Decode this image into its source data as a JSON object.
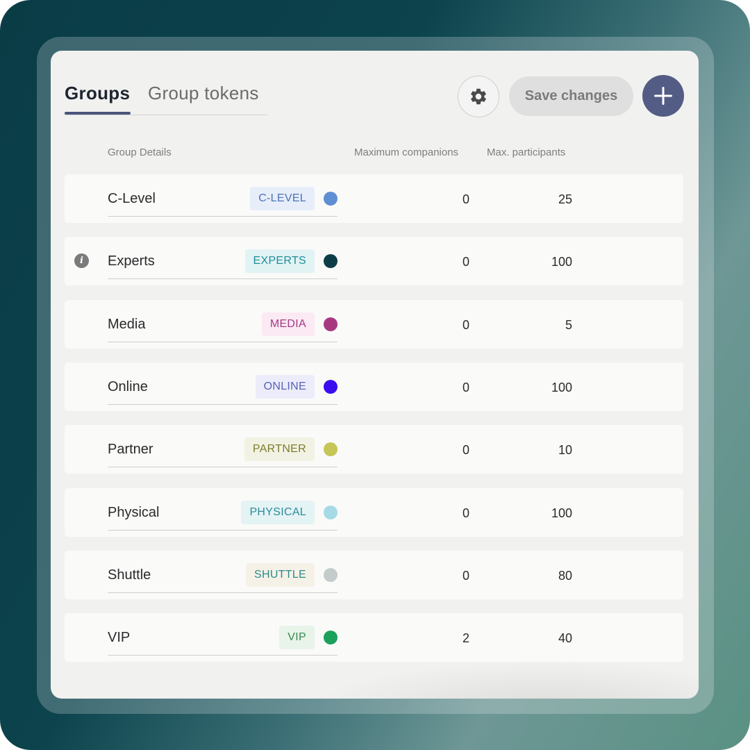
{
  "tabs": [
    {
      "label": "Groups",
      "active": true
    },
    {
      "label": "Group tokens",
      "active": false
    }
  ],
  "toolbar": {
    "settings_icon": "gear-icon",
    "save_label": "Save changes",
    "add_icon": "plus-icon"
  },
  "columns": {
    "details": "Group Details",
    "companions": "Maximum companions",
    "participants": "Max. participants"
  },
  "rows": [
    {
      "name": "C-Level",
      "tag": "C-LEVEL",
      "tag_color": "#4a72b8",
      "tag_bg": "#e7eefa",
      "dot_color": "#5e8fd3",
      "companions": "0",
      "participants": "25",
      "info": false
    },
    {
      "name": "Experts",
      "tag": "EXPERTS",
      "tag_color": "#1f8e9a",
      "tag_bg": "#e2f3f4",
      "dot_color": "#0d3e47",
      "companions": "0",
      "participants": "100",
      "info": true
    },
    {
      "name": "Media",
      "tag": "MEDIA",
      "tag_color": "#a23a86",
      "tag_bg": "#fbe9f3",
      "dot_color": "#a83981",
      "companions": "0",
      "participants": "5",
      "info": false
    },
    {
      "name": "Online",
      "tag": "ONLINE",
      "tag_color": "#5a62b4",
      "tag_bg": "#ececfa",
      "dot_color": "#3b0ef0",
      "companions": "0",
      "participants": "100",
      "info": false
    },
    {
      "name": "Partner",
      "tag": "PARTNER",
      "tag_color": "#7c7c2a",
      "tag_bg": "#f2f2e4",
      "dot_color": "#c6c657",
      "companions": "0",
      "participants": "10",
      "info": false
    },
    {
      "name": "Physical",
      "tag": "PHYSICAL",
      "tag_color": "#2a8c9b",
      "tag_bg": "#e4f3f4",
      "dot_color": "#a6dbe5",
      "companions": "0",
      "participants": "100",
      "info": false
    },
    {
      "name": "Shuttle",
      "tag": "SHUTTLE",
      "tag_color": "#2a8c8a",
      "tag_bg": "#f6f1e7",
      "dot_color": "#c3cbcb",
      "companions": "0",
      "participants": "80",
      "info": false
    },
    {
      "name": "VIP",
      "tag": "VIP",
      "tag_color": "#3a8a4a",
      "tag_bg": "#e8f3ea",
      "dot_color": "#1ba15c",
      "companions": "2",
      "participants": "40",
      "info": false
    }
  ]
}
